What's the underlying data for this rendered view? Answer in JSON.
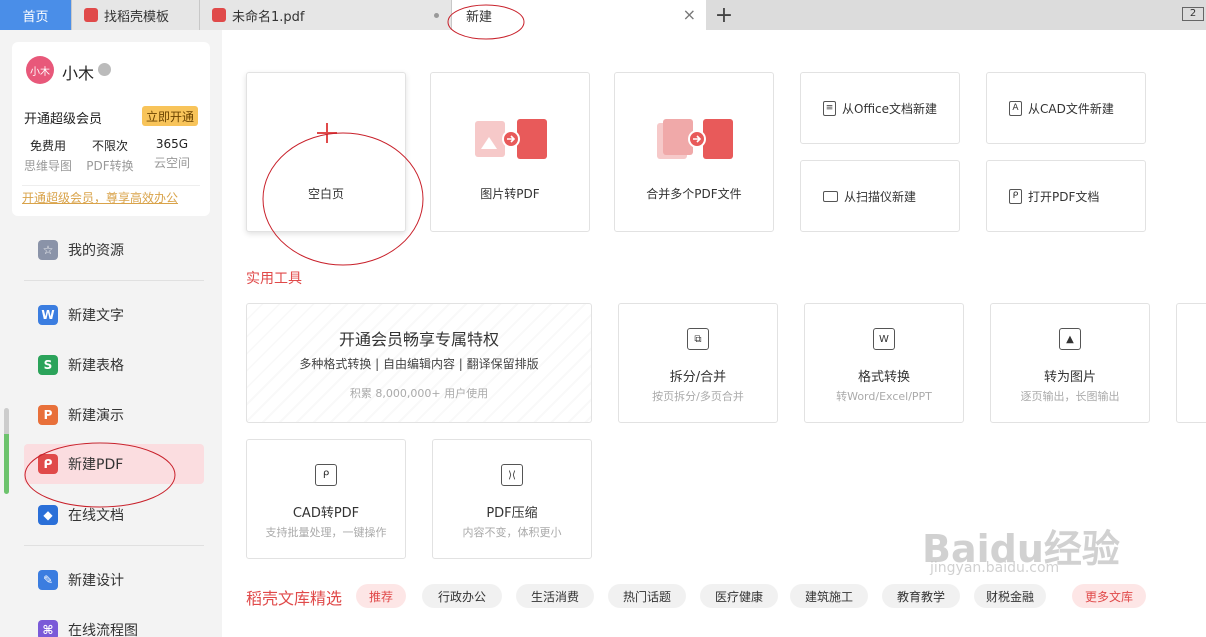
{
  "tabs": {
    "home": "首页",
    "template": "找稻壳模板",
    "doc": "未命名1.pdf",
    "new": "新建",
    "close": "×",
    "add": "+",
    "window_count": "2"
  },
  "profile": {
    "avatar": "小木",
    "name": "小木",
    "vip_text": "开通超级会员",
    "open_button": "立即开通",
    "benefits": [
      {
        "value": "免费用",
        "label": "思维导图"
      },
      {
        "value": "不限次",
        "label": "PDF转换"
      },
      {
        "value": "365G",
        "label": "云空间"
      }
    ],
    "promo": "开通超级会员，尊享高效办公"
  },
  "nav": {
    "resources": "我的资源",
    "writer": "新建文字",
    "sheet": "新建表格",
    "present": "新建演示",
    "pdf": "新建PDF",
    "online_doc": "在线文档",
    "design": "新建设计",
    "flowchart": "在线流程图"
  },
  "create": {
    "blank": "空白页",
    "img_to_pdf": "图片转PDF",
    "merge": "合并多个PDF文件",
    "from_office": "从Office文档新建",
    "from_cad": "从CAD文件新建",
    "from_scanner": "从扫描仪新建",
    "open_pdf": "打开PDF文档"
  },
  "tools": {
    "section_title": "实用工具",
    "vip_title": "开通会员畅享专属特权",
    "vip_features": "多种格式转换 | 自由编辑内容 | 翻译保留排版",
    "vip_users": "积累 8,000,000+ 用户使用",
    "items": [
      {
        "title": "拆分/合并",
        "sub": "按页拆分/多页合并"
      },
      {
        "title": "格式转换",
        "sub": "转Word/Excel/PPT"
      },
      {
        "title": "转为图片",
        "sub": "逐页输出，长图输出"
      },
      {
        "title": "CAD转PDF",
        "sub": "支持批量处理，一键操作"
      },
      {
        "title": "PDF压缩",
        "sub": "内容不变，体积更小"
      }
    ]
  },
  "library": {
    "title": "稻壳文库精选",
    "chips": [
      "推荐",
      "行政办公",
      "生活消费",
      "热门话题",
      "医疗健康",
      "建筑施工",
      "教育教学",
      "财税金融",
      "更多文库"
    ]
  },
  "watermark": {
    "brand": "Baidu经验",
    "url": "jingyan.baidu.com"
  }
}
